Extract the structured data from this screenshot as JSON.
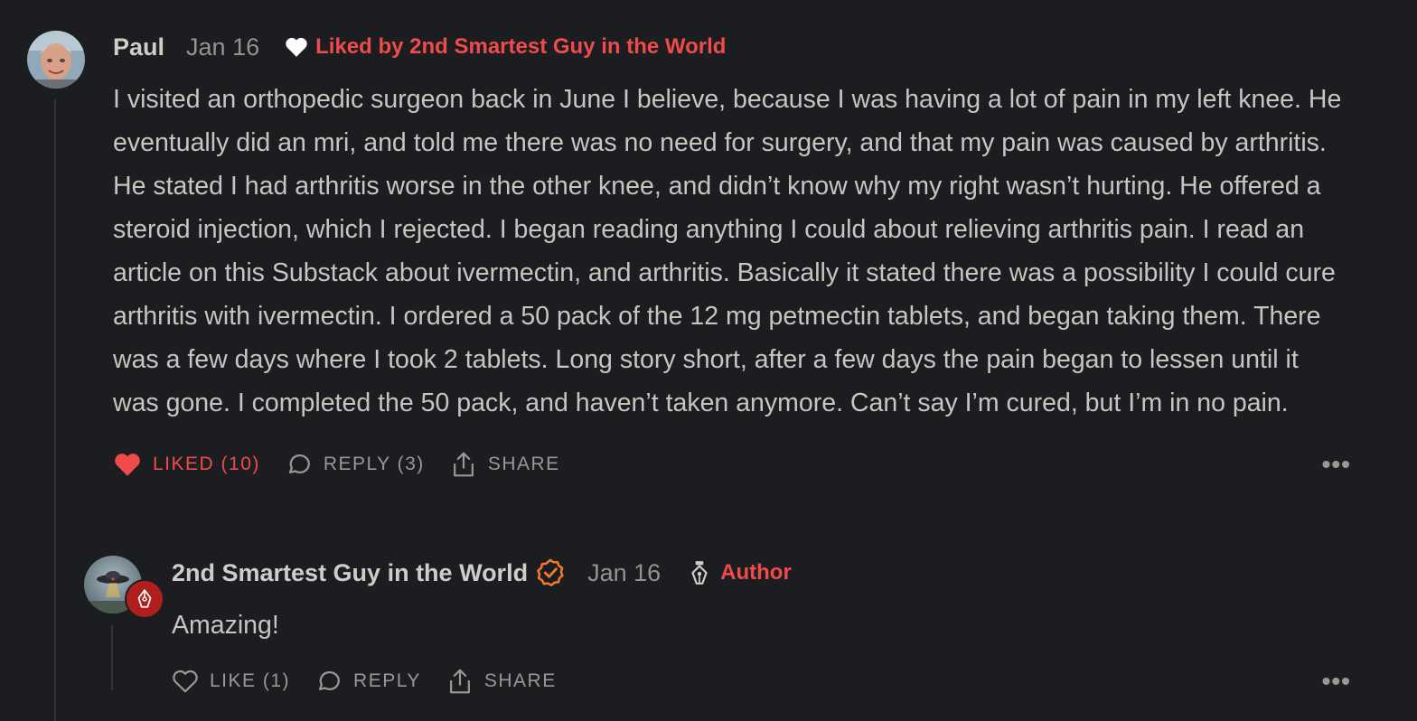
{
  "comment": {
    "author": "Paul",
    "date": "Jan 16",
    "liked_by": "Liked by 2nd Smartest Guy in the World",
    "body": "I visited an orthopedic surgeon back in June I believe, because I was having a lot of pain in my left knee. He eventually did an mri, and told me there was no need for surgery, and that my pain was caused by arthritis. He stated I had arthritis worse in the other knee, and didn’t know why my right wasn’t hurting. He offered a steroid injection, which I rejected. I began reading anything I could about relieving arthritis pain. I read an article on this Substack about ivermectin, and arthritis. Basically it stated there was a possibility I could cure arthritis with ivermectin. I ordered a 50 pack of the 12 mg petmectin tablets, and began taking them. There was a few days where I took 2 tablets. Long story short, after a few days the pain began to lessen until it was gone. I completed the 50 pack, and haven’t taken anymore. Can’t say I’m cured, but I’m in no pain.",
    "actions": {
      "like_label": "LIKED (10)",
      "reply_label": "REPLY (3)",
      "share_label": "SHARE",
      "more_label": "•••"
    }
  },
  "reply": {
    "author": "2nd Smartest Guy in the World",
    "date": "Jan 16",
    "author_tag": "Author",
    "body": "Amazing!",
    "actions": {
      "like_label": "LIKE (1)",
      "reply_label": "REPLY",
      "share_label": "SHARE",
      "more_label": "•••"
    }
  },
  "colors": {
    "background": "#1c1d20",
    "accent_red": "#ef4b4b",
    "verified_orange": "#f07a2a",
    "text": "#c8c5c0",
    "muted": "#9b9892"
  },
  "icons": [
    "avatar",
    "heart-icon",
    "comment-bubble-icon",
    "share-icon",
    "more-icon",
    "verified-badge-icon",
    "pen-nib-icon"
  ]
}
